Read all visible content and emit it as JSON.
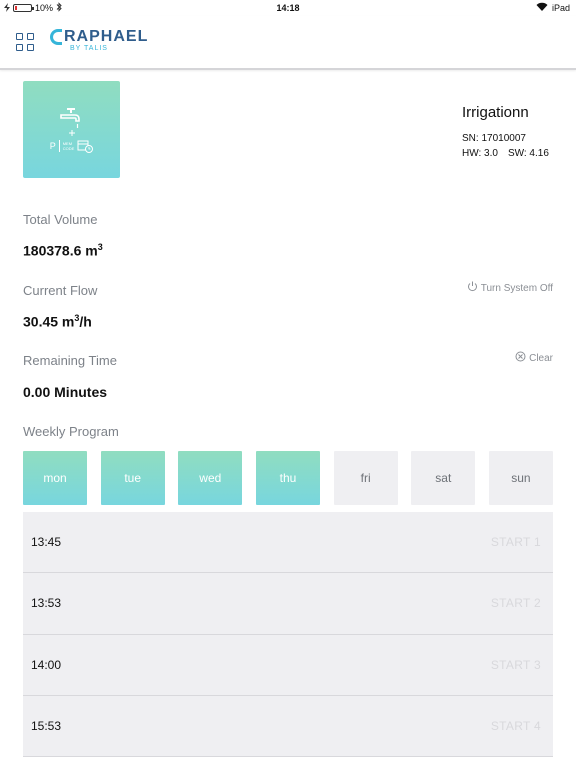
{
  "status_bar": {
    "battery": "10%",
    "battery_level": 0.1,
    "time": "14:18",
    "device": "iPad",
    "icons": [
      "charging-icon",
      "battery-icon",
      "bluetooth-icon",
      "wifi-icon"
    ]
  },
  "header": {
    "logo_main": "RAPHAEL",
    "logo_sub": "BY TALIS",
    "brand_color": "#2f5d8c",
    "accent_color": "#36b5d9"
  },
  "device": {
    "name": "Irrigationn",
    "sn": "SN: 17010007",
    "hw": "HW: 3.0",
    "sw": "SW: 4.16",
    "tile_icon": "faucet-icon",
    "tile_mode": "P",
    "tile_text": "MEM\nCODE"
  },
  "total_volume": {
    "label": "Total Volume",
    "value": "180378.6 m",
    "unit_sup": "3"
  },
  "current_flow": {
    "label": "Current Flow",
    "value": "30.45 m",
    "unit_sup": "3",
    "unit_suffix": "/h",
    "action": "Turn System Off"
  },
  "remaining_time": {
    "label": "Remaining Time",
    "value": "0.00 Minutes",
    "action": "Clear"
  },
  "weekly_program": {
    "label": "Weekly Program",
    "days": [
      {
        "name": "mon",
        "active": true
      },
      {
        "name": "tue",
        "active": true
      },
      {
        "name": "wed",
        "active": true
      },
      {
        "name": "thu",
        "active": true
      },
      {
        "name": "fri",
        "active": false
      },
      {
        "name": "sat",
        "active": false
      },
      {
        "name": "sun",
        "active": false
      }
    ],
    "slots": [
      {
        "time": "13:45",
        "label": "START 1"
      },
      {
        "time": "13:53",
        "label": "START 2"
      },
      {
        "time": "14:00",
        "label": "START 3"
      },
      {
        "time": "15:53",
        "label": "START 4"
      }
    ]
  }
}
